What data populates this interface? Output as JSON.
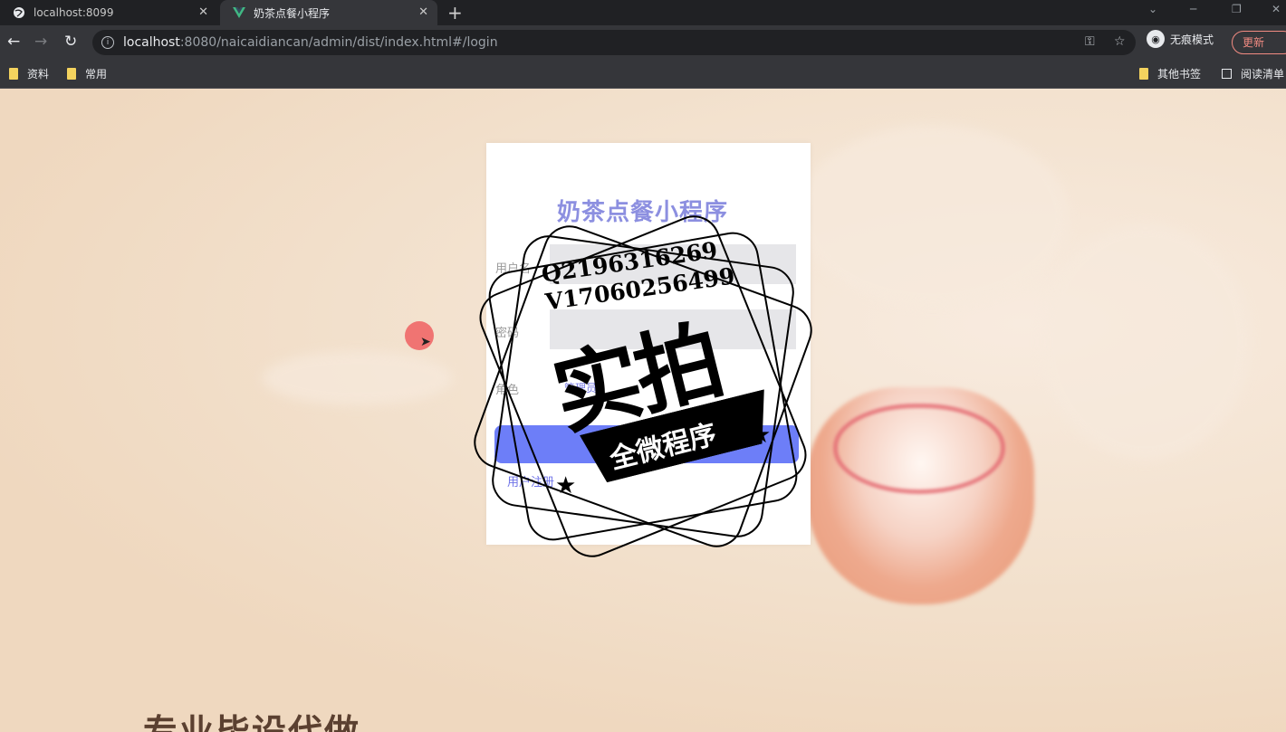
{
  "browser": {
    "tabs": [
      {
        "title": "localhost:8099",
        "active": false,
        "icon": "globe-icon"
      },
      {
        "title": "奶茶点餐小程序",
        "active": true,
        "icon": "vue-logo-icon"
      }
    ],
    "address": {
      "host": "localhost",
      "rest": ":8080/naicaidiancan/admin/dist/index.html#/login"
    },
    "incognito_label": "无痕模式",
    "update_label": "更新",
    "bookmarks": [
      "资料",
      "常用"
    ],
    "bookmarks_right": [
      "其他书签",
      "阅读清单"
    ]
  },
  "login": {
    "title": "奶茶点餐小程序",
    "username_label": "用户名",
    "password_label": "密码",
    "role_label": "角色",
    "role_option": "管理员",
    "login_button": "登录",
    "register_link": "用户注册"
  },
  "watermark": {
    "contact_q": "Q2196316269",
    "contact_v": "V17060256499",
    "big_text": "实拍",
    "band_text": "全微程序"
  },
  "promo_text": "专业毕设代做",
  "colors": {
    "accent": "#6d7ef8",
    "title": "#8c8fe0",
    "background": "#f1dcc4"
  }
}
